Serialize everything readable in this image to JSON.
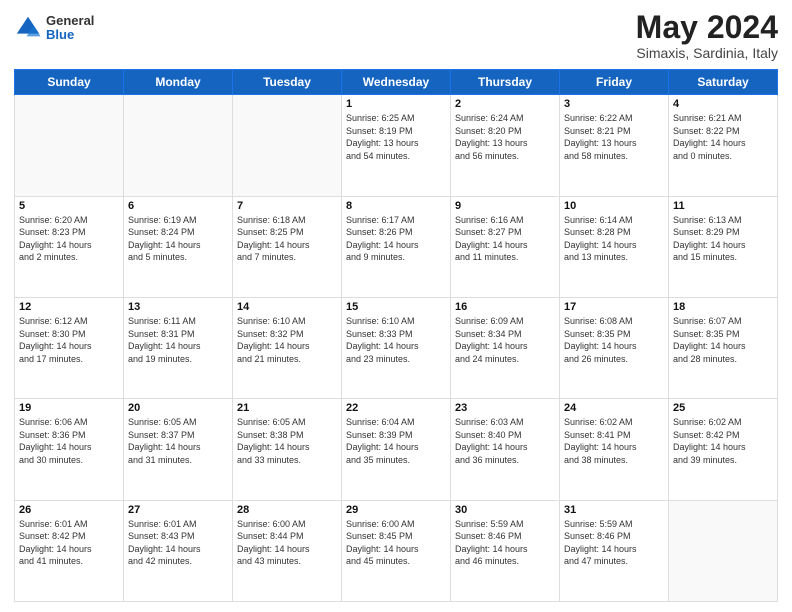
{
  "header": {
    "logo_general": "General",
    "logo_blue": "Blue",
    "title": "May 2024",
    "location": "Simaxis, Sardinia, Italy"
  },
  "weekdays": [
    "Sunday",
    "Monday",
    "Tuesday",
    "Wednesday",
    "Thursday",
    "Friday",
    "Saturday"
  ],
  "weeks": [
    [
      {
        "day": "",
        "content": ""
      },
      {
        "day": "",
        "content": ""
      },
      {
        "day": "",
        "content": ""
      },
      {
        "day": "1",
        "content": "Sunrise: 6:25 AM\nSunset: 8:19 PM\nDaylight: 13 hours\nand 54 minutes."
      },
      {
        "day": "2",
        "content": "Sunrise: 6:24 AM\nSunset: 8:20 PM\nDaylight: 13 hours\nand 56 minutes."
      },
      {
        "day": "3",
        "content": "Sunrise: 6:22 AM\nSunset: 8:21 PM\nDaylight: 13 hours\nand 58 minutes."
      },
      {
        "day": "4",
        "content": "Sunrise: 6:21 AM\nSunset: 8:22 PM\nDaylight: 14 hours\nand 0 minutes."
      }
    ],
    [
      {
        "day": "5",
        "content": "Sunrise: 6:20 AM\nSunset: 8:23 PM\nDaylight: 14 hours\nand 2 minutes."
      },
      {
        "day": "6",
        "content": "Sunrise: 6:19 AM\nSunset: 8:24 PM\nDaylight: 14 hours\nand 5 minutes."
      },
      {
        "day": "7",
        "content": "Sunrise: 6:18 AM\nSunset: 8:25 PM\nDaylight: 14 hours\nand 7 minutes."
      },
      {
        "day": "8",
        "content": "Sunrise: 6:17 AM\nSunset: 8:26 PM\nDaylight: 14 hours\nand 9 minutes."
      },
      {
        "day": "9",
        "content": "Sunrise: 6:16 AM\nSunset: 8:27 PM\nDaylight: 14 hours\nand 11 minutes."
      },
      {
        "day": "10",
        "content": "Sunrise: 6:14 AM\nSunset: 8:28 PM\nDaylight: 14 hours\nand 13 minutes."
      },
      {
        "day": "11",
        "content": "Sunrise: 6:13 AM\nSunset: 8:29 PM\nDaylight: 14 hours\nand 15 minutes."
      }
    ],
    [
      {
        "day": "12",
        "content": "Sunrise: 6:12 AM\nSunset: 8:30 PM\nDaylight: 14 hours\nand 17 minutes."
      },
      {
        "day": "13",
        "content": "Sunrise: 6:11 AM\nSunset: 8:31 PM\nDaylight: 14 hours\nand 19 minutes."
      },
      {
        "day": "14",
        "content": "Sunrise: 6:10 AM\nSunset: 8:32 PM\nDaylight: 14 hours\nand 21 minutes."
      },
      {
        "day": "15",
        "content": "Sunrise: 6:10 AM\nSunset: 8:33 PM\nDaylight: 14 hours\nand 23 minutes."
      },
      {
        "day": "16",
        "content": "Sunrise: 6:09 AM\nSunset: 8:34 PM\nDaylight: 14 hours\nand 24 minutes."
      },
      {
        "day": "17",
        "content": "Sunrise: 6:08 AM\nSunset: 8:35 PM\nDaylight: 14 hours\nand 26 minutes."
      },
      {
        "day": "18",
        "content": "Sunrise: 6:07 AM\nSunset: 8:35 PM\nDaylight: 14 hours\nand 28 minutes."
      }
    ],
    [
      {
        "day": "19",
        "content": "Sunrise: 6:06 AM\nSunset: 8:36 PM\nDaylight: 14 hours\nand 30 minutes."
      },
      {
        "day": "20",
        "content": "Sunrise: 6:05 AM\nSunset: 8:37 PM\nDaylight: 14 hours\nand 31 minutes."
      },
      {
        "day": "21",
        "content": "Sunrise: 6:05 AM\nSunset: 8:38 PM\nDaylight: 14 hours\nand 33 minutes."
      },
      {
        "day": "22",
        "content": "Sunrise: 6:04 AM\nSunset: 8:39 PM\nDaylight: 14 hours\nand 35 minutes."
      },
      {
        "day": "23",
        "content": "Sunrise: 6:03 AM\nSunset: 8:40 PM\nDaylight: 14 hours\nand 36 minutes."
      },
      {
        "day": "24",
        "content": "Sunrise: 6:02 AM\nSunset: 8:41 PM\nDaylight: 14 hours\nand 38 minutes."
      },
      {
        "day": "25",
        "content": "Sunrise: 6:02 AM\nSunset: 8:42 PM\nDaylight: 14 hours\nand 39 minutes."
      }
    ],
    [
      {
        "day": "26",
        "content": "Sunrise: 6:01 AM\nSunset: 8:42 PM\nDaylight: 14 hours\nand 41 minutes."
      },
      {
        "day": "27",
        "content": "Sunrise: 6:01 AM\nSunset: 8:43 PM\nDaylight: 14 hours\nand 42 minutes."
      },
      {
        "day": "28",
        "content": "Sunrise: 6:00 AM\nSunset: 8:44 PM\nDaylight: 14 hours\nand 43 minutes."
      },
      {
        "day": "29",
        "content": "Sunrise: 6:00 AM\nSunset: 8:45 PM\nDaylight: 14 hours\nand 45 minutes."
      },
      {
        "day": "30",
        "content": "Sunrise: 5:59 AM\nSunset: 8:46 PM\nDaylight: 14 hours\nand 46 minutes."
      },
      {
        "day": "31",
        "content": "Sunrise: 5:59 AM\nSunset: 8:46 PM\nDaylight: 14 hours\nand 47 minutes."
      },
      {
        "day": "",
        "content": ""
      }
    ]
  ]
}
